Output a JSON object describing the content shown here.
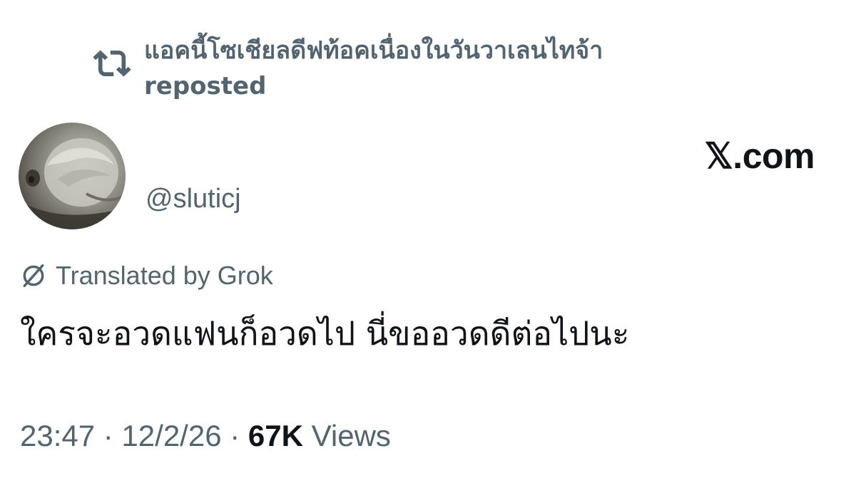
{
  "repost": {
    "icon": "repost-icon",
    "text": "แอคนี้โซเชียลดีฟท้อคเนื่องในวันวาเลนไทจ้า reposted"
  },
  "brand": {
    "label": "𝕏.com"
  },
  "author": {
    "avatar": "avatar",
    "handle": "@sluticj"
  },
  "translation": {
    "icon": "globe-slash-icon",
    "label": "Translated by Grok"
  },
  "tweet": {
    "text": "ใครจะอวดแฟนก็อวดไป นี่ขออวดดีต่อไปนะ"
  },
  "meta": {
    "time": "23:47",
    "separator": " · ",
    "date": "12/2/26",
    "views_count": "67K",
    "views_label": "Views"
  },
  "colors": {
    "primary_text": "#0f1419",
    "secondary_text": "#536471",
    "background": "#ffffff"
  }
}
